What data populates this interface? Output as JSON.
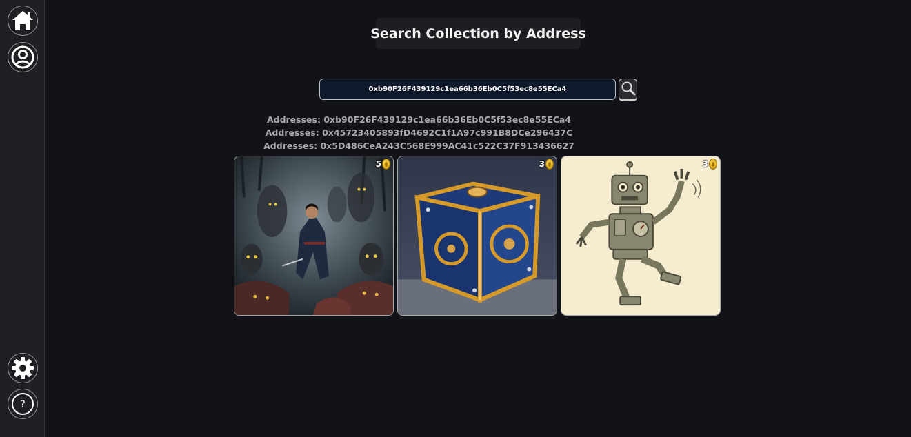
{
  "sidebar": {
    "items": [
      {
        "icon": "home-icon"
      },
      {
        "icon": "user-profile-icon"
      },
      {
        "icon": "gear-icon"
      },
      {
        "icon": "help-icon",
        "glyph": "?"
      }
    ]
  },
  "header": {
    "title": "Search Collection by Address"
  },
  "search": {
    "value": "0xb90F26F439129c1ea66b36Eb0C5f53ec8e55ECa4",
    "button_icon": "search-icon"
  },
  "addresses": [
    "Addresses: 0xb90F26F439129c1ea66b36Eb0C5f53ec8e55ECa4",
    "Addresses: 0x45723405893fD4692C1f1A97c991B8DCe296437C",
    "Addresses: 0x5D486CeA243C568E999AC41c522C37F913436627"
  ],
  "cards": [
    {
      "count": "5",
      "image": "dark-fantasy-warrior-among-ghouls",
      "badge_icon": "coin-icon"
    },
    {
      "count": "3",
      "image": "ornate-blue-gold-cube-box",
      "badge_icon": "coin-icon"
    },
    {
      "count": "3",
      "image": "sketch-dancing-robot",
      "badge_icon": "coin-icon"
    }
  ],
  "colors": {
    "background": "#121318",
    "sidebar": "#1f2023",
    "input_bg": "#0e1a2b",
    "text_muted": "#a9a9ad"
  }
}
